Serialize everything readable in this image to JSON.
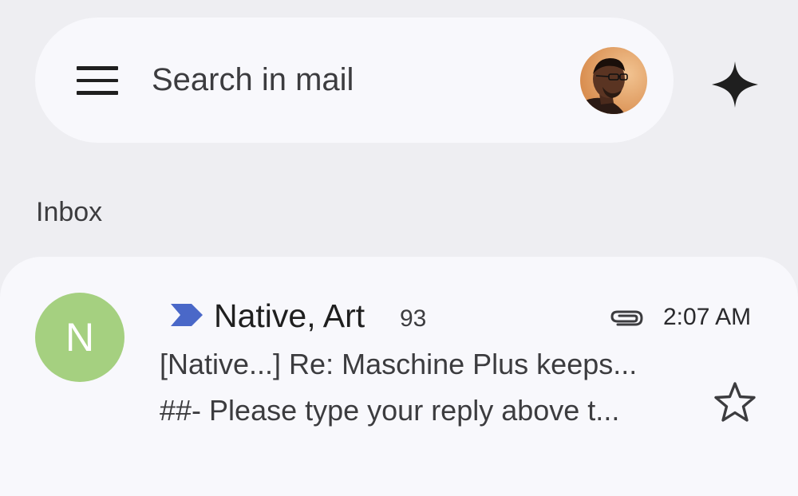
{
  "search": {
    "placeholder": "Search in mail"
  },
  "header": {
    "menu_icon": "hamburger-menu-icon",
    "account_avatar": "account-avatar-photo",
    "gemini_icon": "sparkle-icon"
  },
  "section": {
    "label": "Inbox"
  },
  "email": {
    "avatar_letter": "N",
    "avatar_color": "#a5d080",
    "sender": "Native, Art",
    "count": "93",
    "time": "2:07 AM",
    "subject": "[Native...] Re: Maschine Plus keeps...",
    "snippet": "##- Please type your reply above t...",
    "importance_color": "#4a68c8",
    "has_attachment": true,
    "starred": false
  }
}
